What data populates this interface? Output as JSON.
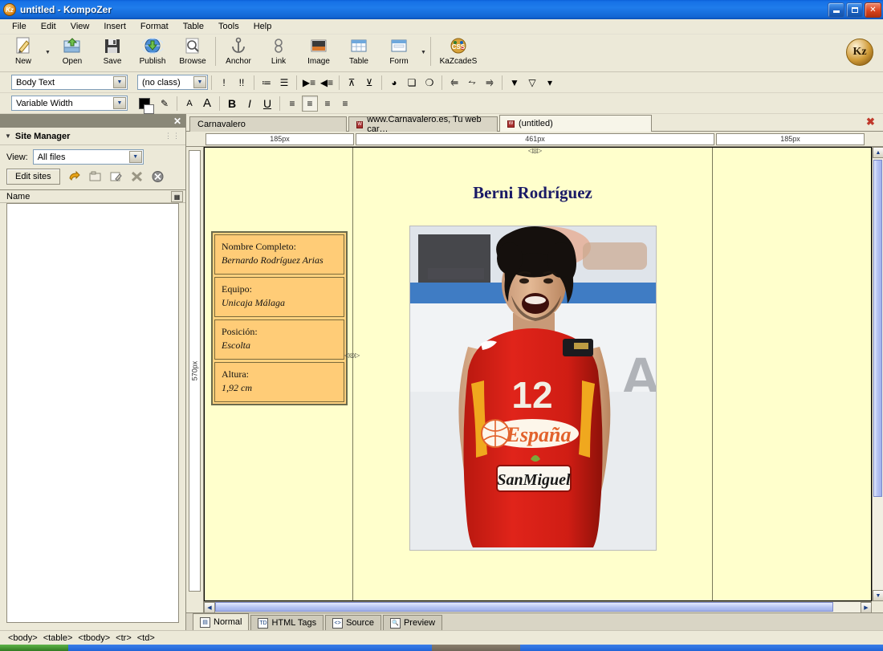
{
  "window": {
    "title": "untitled - KompoZer",
    "app_icon": "kompozer-logo-icon",
    "minimize": "_",
    "maximize": "□",
    "close": "✕"
  },
  "menubar": [
    {
      "label": "File",
      "accel": "F"
    },
    {
      "label": "Edit",
      "accel": "E"
    },
    {
      "label": "View",
      "accel": "V"
    },
    {
      "label": "Insert",
      "accel": "I"
    },
    {
      "label": "Format",
      "accel": "o"
    },
    {
      "label": "Table",
      "accel": "b"
    },
    {
      "label": "Tools",
      "accel": "T"
    },
    {
      "label": "Help",
      "accel": "H"
    }
  ],
  "toolbar": {
    "buttons": [
      {
        "label": "New",
        "icon": "new-document-icon",
        "dropdown": true
      },
      {
        "label": "Open",
        "icon": "open-folder-icon",
        "dropdown": false
      },
      {
        "label": "Save",
        "icon": "floppy-disk-icon",
        "dropdown": false
      },
      {
        "label": "Publish",
        "icon": "globe-upload-icon",
        "dropdown": false
      },
      {
        "label": "Browse",
        "icon": "magnifier-page-icon",
        "dropdown": false
      },
      {
        "label": "Anchor",
        "icon": "anchor-icon",
        "dropdown": false
      },
      {
        "label": "Link",
        "icon": "chain-link-icon",
        "dropdown": false
      },
      {
        "label": "Image",
        "icon": "picture-icon",
        "dropdown": false
      },
      {
        "label": "Table",
        "icon": "table-grid-icon",
        "dropdown": false
      },
      {
        "label": "Form",
        "icon": "form-window-icon",
        "dropdown": true
      },
      {
        "label": "KaZcadeS",
        "icon": "css-palette-icon",
        "dropdown": false
      }
    ],
    "logo_button": "Kz"
  },
  "format_bar": {
    "paragraph_style": "Body Text",
    "class_select": "(no class)",
    "buttons": [
      {
        "name": "decrease-priority-icon",
        "glyph": "!"
      },
      {
        "name": "increase-priority-icon",
        "glyph": "!!"
      },
      {
        "name": "numbered-list-icon",
        "glyph": "≔"
      },
      {
        "name": "bulleted-list-icon",
        "glyph": "☰"
      },
      {
        "name": "indent-more-icon",
        "glyph": "▶≡"
      },
      {
        "name": "indent-less-icon",
        "glyph": "◀≡"
      },
      {
        "name": "align-top-icon",
        "glyph": "⊼"
      },
      {
        "name": "align-bottom-icon",
        "glyph": "⊻"
      },
      {
        "name": "insert-object-icon",
        "glyph": "◕"
      },
      {
        "name": "duplicate-icon",
        "glyph": "❏"
      },
      {
        "name": "group-icon",
        "glyph": "❍"
      },
      {
        "name": "move-left-icon",
        "glyph": "⥢"
      },
      {
        "name": "center-h-icon",
        "glyph": "⥊"
      },
      {
        "name": "move-right-icon",
        "glyph": "⥤"
      },
      {
        "name": "layer-top-icon",
        "glyph": "▼"
      },
      {
        "name": "layer-middle-icon",
        "glyph": "▽"
      },
      {
        "name": "layer-bottom-icon",
        "glyph": "▾"
      }
    ]
  },
  "font_bar": {
    "font_family": "Variable Width",
    "text_color_swatch": "#000000",
    "buttons": [
      {
        "name": "highlight-pen-icon",
        "glyph": "✎"
      },
      {
        "name": "decrease-font-icon",
        "glyph": "A"
      },
      {
        "name": "increase-font-icon",
        "glyph": "A"
      },
      {
        "name": "bold-icon",
        "glyph": "B"
      },
      {
        "name": "italic-icon",
        "glyph": "I"
      },
      {
        "name": "underline-icon",
        "glyph": "U"
      },
      {
        "name": "align-left-icon",
        "glyph": "≡"
      },
      {
        "name": "align-center-icon",
        "glyph": "≡"
      },
      {
        "name": "align-right-icon",
        "glyph": "≡"
      },
      {
        "name": "align-justify-icon",
        "glyph": "≡"
      }
    ],
    "active_alignment": "align-center-icon"
  },
  "site_manager": {
    "title": "Site Manager",
    "close": "✕",
    "view_label": "View:",
    "view_value": "All files",
    "edit_sites_label": "Edit sites",
    "tool_icons": [
      {
        "name": "undo-arrow-icon",
        "glyph": "↰"
      },
      {
        "name": "new-folder-icon",
        "glyph": "▣"
      },
      {
        "name": "edit-page-icon",
        "glyph": "✎"
      },
      {
        "name": "delete-icon",
        "glyph": "✖"
      },
      {
        "name": "stop-icon",
        "glyph": "⊗"
      }
    ],
    "column_header": "Name",
    "column_button": "▦"
  },
  "document_tabs": [
    {
      "label": "Carnavalero",
      "has_favicon": false,
      "active": false
    },
    {
      "label": "www.Carnavalero.es, Tu web car…",
      "has_favicon": true,
      "favicon": "W",
      "active": false
    },
    {
      "label": "(untitled)",
      "has_favicon": true,
      "favicon": "W",
      "active": true
    }
  ],
  "tab_close_all": "✖",
  "rulers": {
    "horizontal": [
      "185px",
      "461px",
      "185px"
    ],
    "vertical": "570px",
    "column_handle": "◁◎▷",
    "row_handle": "◁◎▷"
  },
  "page": {
    "title": "Berni Rodríguez",
    "background_color": "#ffffcc",
    "title_color": "#1a1a66",
    "table_bg": "#ffcc77",
    "table_border": "#6b6b4d",
    "info_rows": [
      {
        "key": "Nombre Completo:",
        "value": "Bernardo Rodríguez Arias"
      },
      {
        "key": "Equipo:",
        "value": "Unicaja Málaga"
      },
      {
        "key": "Posición:",
        "value": "Escolta"
      },
      {
        "key": "Altura:",
        "value": "1,92 cm"
      }
    ],
    "photo": {
      "alt": "basketball-player-photo",
      "jersey_number": "12",
      "jersey_text": "España",
      "sponsor_text": "SanMiguel"
    }
  },
  "view_tabs": [
    {
      "label": "Normal",
      "icon": "page-icon",
      "active": true
    },
    {
      "label": "HTML Tags",
      "icon": "td-tag-icon",
      "active": false
    },
    {
      "label": "Source",
      "icon": "code-icon",
      "active": false
    },
    {
      "label": "Preview",
      "icon": "magnifier-icon",
      "active": false
    }
  ],
  "status_bar": {
    "breadcrumb": [
      "<body>",
      "<table>",
      "<tbody>",
      "<tr>",
      "<td>"
    ]
  }
}
